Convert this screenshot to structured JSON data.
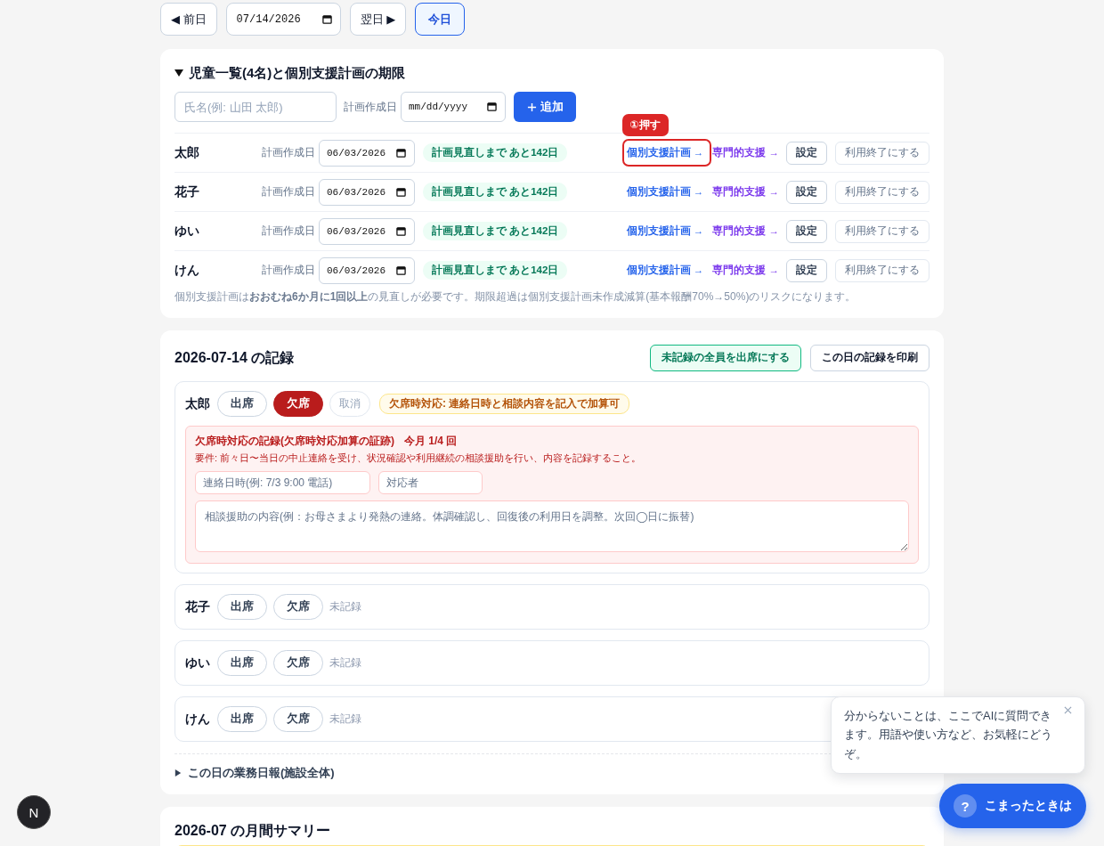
{
  "date_nav": {
    "prev_label": "◀ 前日",
    "date": "07/14/2026",
    "next_label": "翌日 ▶",
    "today_label": "今日"
  },
  "children_panel": {
    "expanded": true,
    "title": "児童一覧(4名)と個別支援計画の期限",
    "name_placeholder": "氏名(例: 山田 太郎)",
    "date_label": "計画作成日",
    "date_placeholder": "mm/dd/yyyy",
    "add_label": "追加",
    "rows": [
      {
        "name": "太郎",
        "date_label": "計画作成日",
        "plan_date": "06/03/2026",
        "deadline_badge": "計画見直しまで あと142日",
        "plan_link": "個別支援計画 →",
        "highlighted": true,
        "callout": "①押す",
        "specialist_link": "専門的支援 →",
        "settings_label": "設定",
        "end_label": "利用終了にする"
      },
      {
        "name": "花子",
        "date_label": "計画作成日",
        "plan_date": "06/03/2026",
        "deadline_badge": "計画見直しまで あと142日",
        "plan_link": "個別支援計画 →",
        "highlighted": false,
        "specialist_link": "専門的支援 →",
        "settings_label": "設定",
        "end_label": "利用終了にする"
      },
      {
        "name": "ゆい",
        "date_label": "計画作成日",
        "plan_date": "06/03/2026",
        "deadline_badge": "計画見直しまで あと142日",
        "plan_link": "個別支援計画 →",
        "highlighted": false,
        "specialist_link": "専門的支援 →",
        "settings_label": "設定",
        "end_label": "利用終了にする"
      },
      {
        "name": "けん",
        "date_label": "計画作成日",
        "plan_date": "06/03/2026",
        "deadline_badge": "計画見直しまで あと142日",
        "plan_link": "個別支援計画 →",
        "highlighted": false,
        "specialist_link": "専門的支援 →",
        "settings_label": "設定",
        "end_label": "利用終了にする"
      }
    ],
    "note": "個別支援計画は**おおむね6か月に1回以上**の見直しが必要です。期限超過は個別支援計画未作成減算(基本報酬70%→50%)のリスクになります。"
  },
  "record_panel": {
    "title": "2026-07-14 の記録",
    "mark_all_label": "未記録の全員を出席にする",
    "print_label": "この日の記録を印刷",
    "records": [
      {
        "name": "太郎",
        "present_selected": false,
        "absent_selected": true,
        "present_label": "出席",
        "absent_label": "欠席",
        "cancel_label": "取消",
        "badge": "欠席時対応: 連絡日時と相談内容を記入で加算可",
        "absence_form": {
          "title": "欠席時対応の記録(欠席時対応加算の証跡)",
          "count": "今月 1/4 回",
          "requirement": "要件: 前々日〜当日の中止連絡を受け、状況確認や利用継続の相談援助を行い、内容を記録すること。",
          "contact_placeholder": "連絡日時(例: 7/3 9:00 電話)",
          "staff_placeholder": "対応者",
          "content_placeholder": "相談援助の内容(例：お母さまより発熱の連絡。体調確認し、回復後の利用日を調整。次回◯日に振替)"
        }
      },
      {
        "name": "花子",
        "present_selected": false,
        "absent_selected": false,
        "present_label": "出席",
        "absent_label": "欠席",
        "status_label": "未記録"
      },
      {
        "name": "ゆい",
        "present_selected": false,
        "absent_selected": false,
        "present_label": "出席",
        "absent_label": "欠席",
        "status_label": "未記録"
      },
      {
        "name": "けん",
        "present_selected": false,
        "absent_selected": false,
        "present_label": "出席",
        "absent_label": "欠席",
        "status_label": "未記録"
      }
    ],
    "daily_report": {
      "expanded": false,
      "title": "この日の業務日報(施設全体)"
    }
  },
  "monthly_summary": {
    "title": "2026-07 の月間サマリー"
  },
  "help": {
    "bubble_text": "分からないことは、ここでAIに質問できます。用語や使い方など、お気軽にどうぞ。",
    "badge": "?",
    "label": "こまったときは"
  },
  "dev_badge": "N"
}
